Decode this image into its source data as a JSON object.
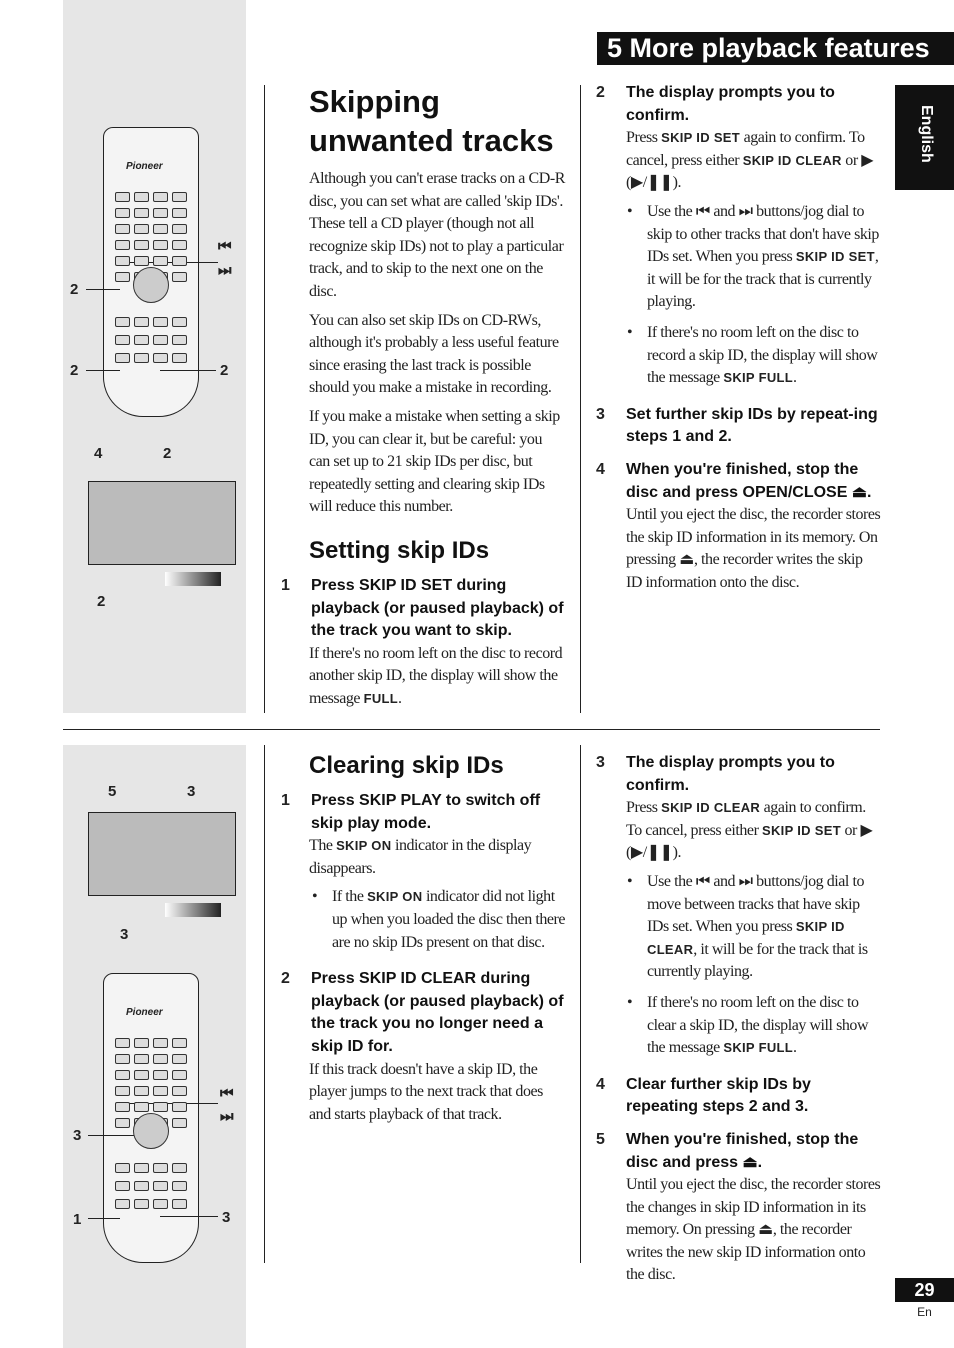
{
  "header": {
    "title": "5 More playback features"
  },
  "side_tab": "English",
  "footer": {
    "page_number": "29",
    "lang": "En"
  },
  "figures": {
    "brand": "Pioneer",
    "prev_icon": "⏮",
    "next_icon": "⏭",
    "top_callouts": [
      "2",
      "2",
      "2",
      "4",
      "2",
      "2"
    ],
    "bottom_callouts": [
      "5",
      "3",
      "3",
      "3",
      "1",
      "3"
    ]
  },
  "top": {
    "title": "Skipping unwanted tracks",
    "intro": [
      "Although you can't erase tracks on a CD-R disc, you can set what are called 'skip IDs'. These tell a CD player (though not all recognize skip IDs) not to play a particular track, and to skip to the next one on the disc.",
      "You can also set skip IDs on CD-RWs, although it's probably a less useful feature since erasing the last track is possible should you make a mistake in recording.",
      "If you make a mistake when setting a skip ID, you can clear it, but be careful: you can set up to 21 skip IDs per disc, but repeatedly setting and clearing skip IDs will reduce this number."
    ],
    "section": "Setting skip IDs",
    "s1": {
      "num": "1",
      "head": "Press SKIP ID SET during playback (or paused playback) of the track you want to skip.",
      "body": [
        "If there's no room left on the disc to record another skip ID, the display will show the message ",
        "FULL",
        "."
      ]
    },
    "s2": {
      "num": "2",
      "head": "The display prompts you to confirm.",
      "body": [
        "Press ",
        "SKIP ID SET",
        " again to confirm. To cancel, press either ",
        "SKIP ID CLEAR",
        " or ▶ (▶/❚❚)."
      ],
      "b1": [
        "Use the ⏮ and ⏭ buttons/jog dial to skip to other tracks that don't have skip IDs set. When you press ",
        "SKIP ID SET",
        ", it will be for the track that is currently playing."
      ],
      "b2": [
        "If there's no room left on the disc to record a skip ID, the display will show the message ",
        "SKIP FULL",
        "."
      ]
    },
    "s3": {
      "num": "3",
      "head": "Set further skip IDs by repeat-ing steps 1 and 2."
    },
    "s4": {
      "num": "4",
      "head": "When you're finished, stop the disc and press OPEN/CLOSE ⏏.",
      "body": "Until you eject the disc, the recorder stores the skip ID information in its memory. On pressing ⏏, the recorder writes the skip ID information onto the disc."
    }
  },
  "bottom": {
    "section": "Clearing skip IDs",
    "s1": {
      "num": "1",
      "head": "Press SKIP PLAY to switch off skip play mode.",
      "body": [
        "The ",
        "SKIP ON",
        " indicator in the display disappears."
      ],
      "b1": [
        "If the ",
        "SKIP ON",
        " indicator did not light up when you loaded the disc then there are no skip IDs present on that disc."
      ]
    },
    "s2": {
      "num": "2",
      "head": "Press SKIP ID CLEAR during playback (or paused playback) of the track you no longer need a skip ID for.",
      "body": "If this track doesn't have a skip ID, the player jumps to the next track that does and starts playback of that track."
    },
    "s3": {
      "num": "3",
      "head": "The display prompts you to confirm.",
      "body": [
        "Press ",
        "SKIP ID CLEAR",
        " again to confirm. To cancel, press either ",
        "SKIP ID SET",
        " or ▶ (▶/❚❚)."
      ],
      "b1": [
        "Use the ⏮ and ⏭ buttons/jog dial to move between tracks that have skip IDs set. When you press ",
        "SKIP ID CLEAR",
        ", it will be for the track that is currently playing."
      ],
      "b2": [
        "If there's no room left on the disc to clear a skip ID, the display will show the message ",
        "SKIP FULL",
        "."
      ]
    },
    "s4": {
      "num": "4",
      "head": "Clear further skip IDs by repeating steps 2 and 3."
    },
    "s5": {
      "num": "5",
      "head": "When you're finished, stop the disc and press ⏏.",
      "body": "Until you eject the disc, the recorder stores the changes in skip ID information in its memory. On pressing ⏏, the recorder writes the new skip ID information onto the disc."
    }
  }
}
